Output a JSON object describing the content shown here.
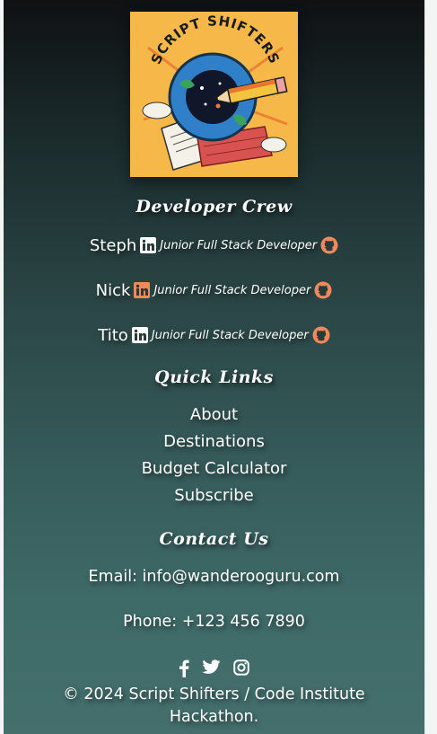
{
  "logo": {
    "text": "SCRIPT SHIFTERS",
    "icon": "globe-pencil-logo"
  },
  "developer_section": {
    "heading": "Developer Crew",
    "developers": [
      {
        "name": "Steph",
        "role": "Junior Full Stack Developer",
        "linkedin_icon": "linkedin-icon",
        "github_icon": "github-icon",
        "linkedin_color": "#ffffff",
        "github_color": "#f08a5d"
      },
      {
        "name": "Nick",
        "role": "Junior Full Stack Developer",
        "linkedin_icon": "linkedin-icon",
        "github_icon": "github-icon",
        "linkedin_color": "#f08a5d",
        "github_color": "#f08a5d"
      },
      {
        "name": "Tito",
        "role": "Junior Full Stack Developer",
        "linkedin_icon": "linkedin-icon",
        "github_icon": "github-icon",
        "linkedin_color": "#ffffff",
        "github_color": "#f08a5d"
      }
    ]
  },
  "quick_links": {
    "heading": "Quick Links",
    "items": [
      "About",
      "Destinations",
      "Budget Calculator",
      "Subscribe"
    ]
  },
  "contact": {
    "heading": "Contact Us",
    "email": "Email: info@wanderooguru.com",
    "phone": "Phone: +123 456 7890"
  },
  "social": {
    "icons": [
      "facebook-icon",
      "twitter-icon",
      "instagram-icon"
    ]
  },
  "copyright": "© 2024 Script Shifters / Code Institute Hackathon.",
  "colors": {
    "accent": "#f08a5d",
    "logo_bg": "#f7b84a",
    "gradient_top": "#0f1113",
    "gradient_bottom": "#446f6d"
  }
}
